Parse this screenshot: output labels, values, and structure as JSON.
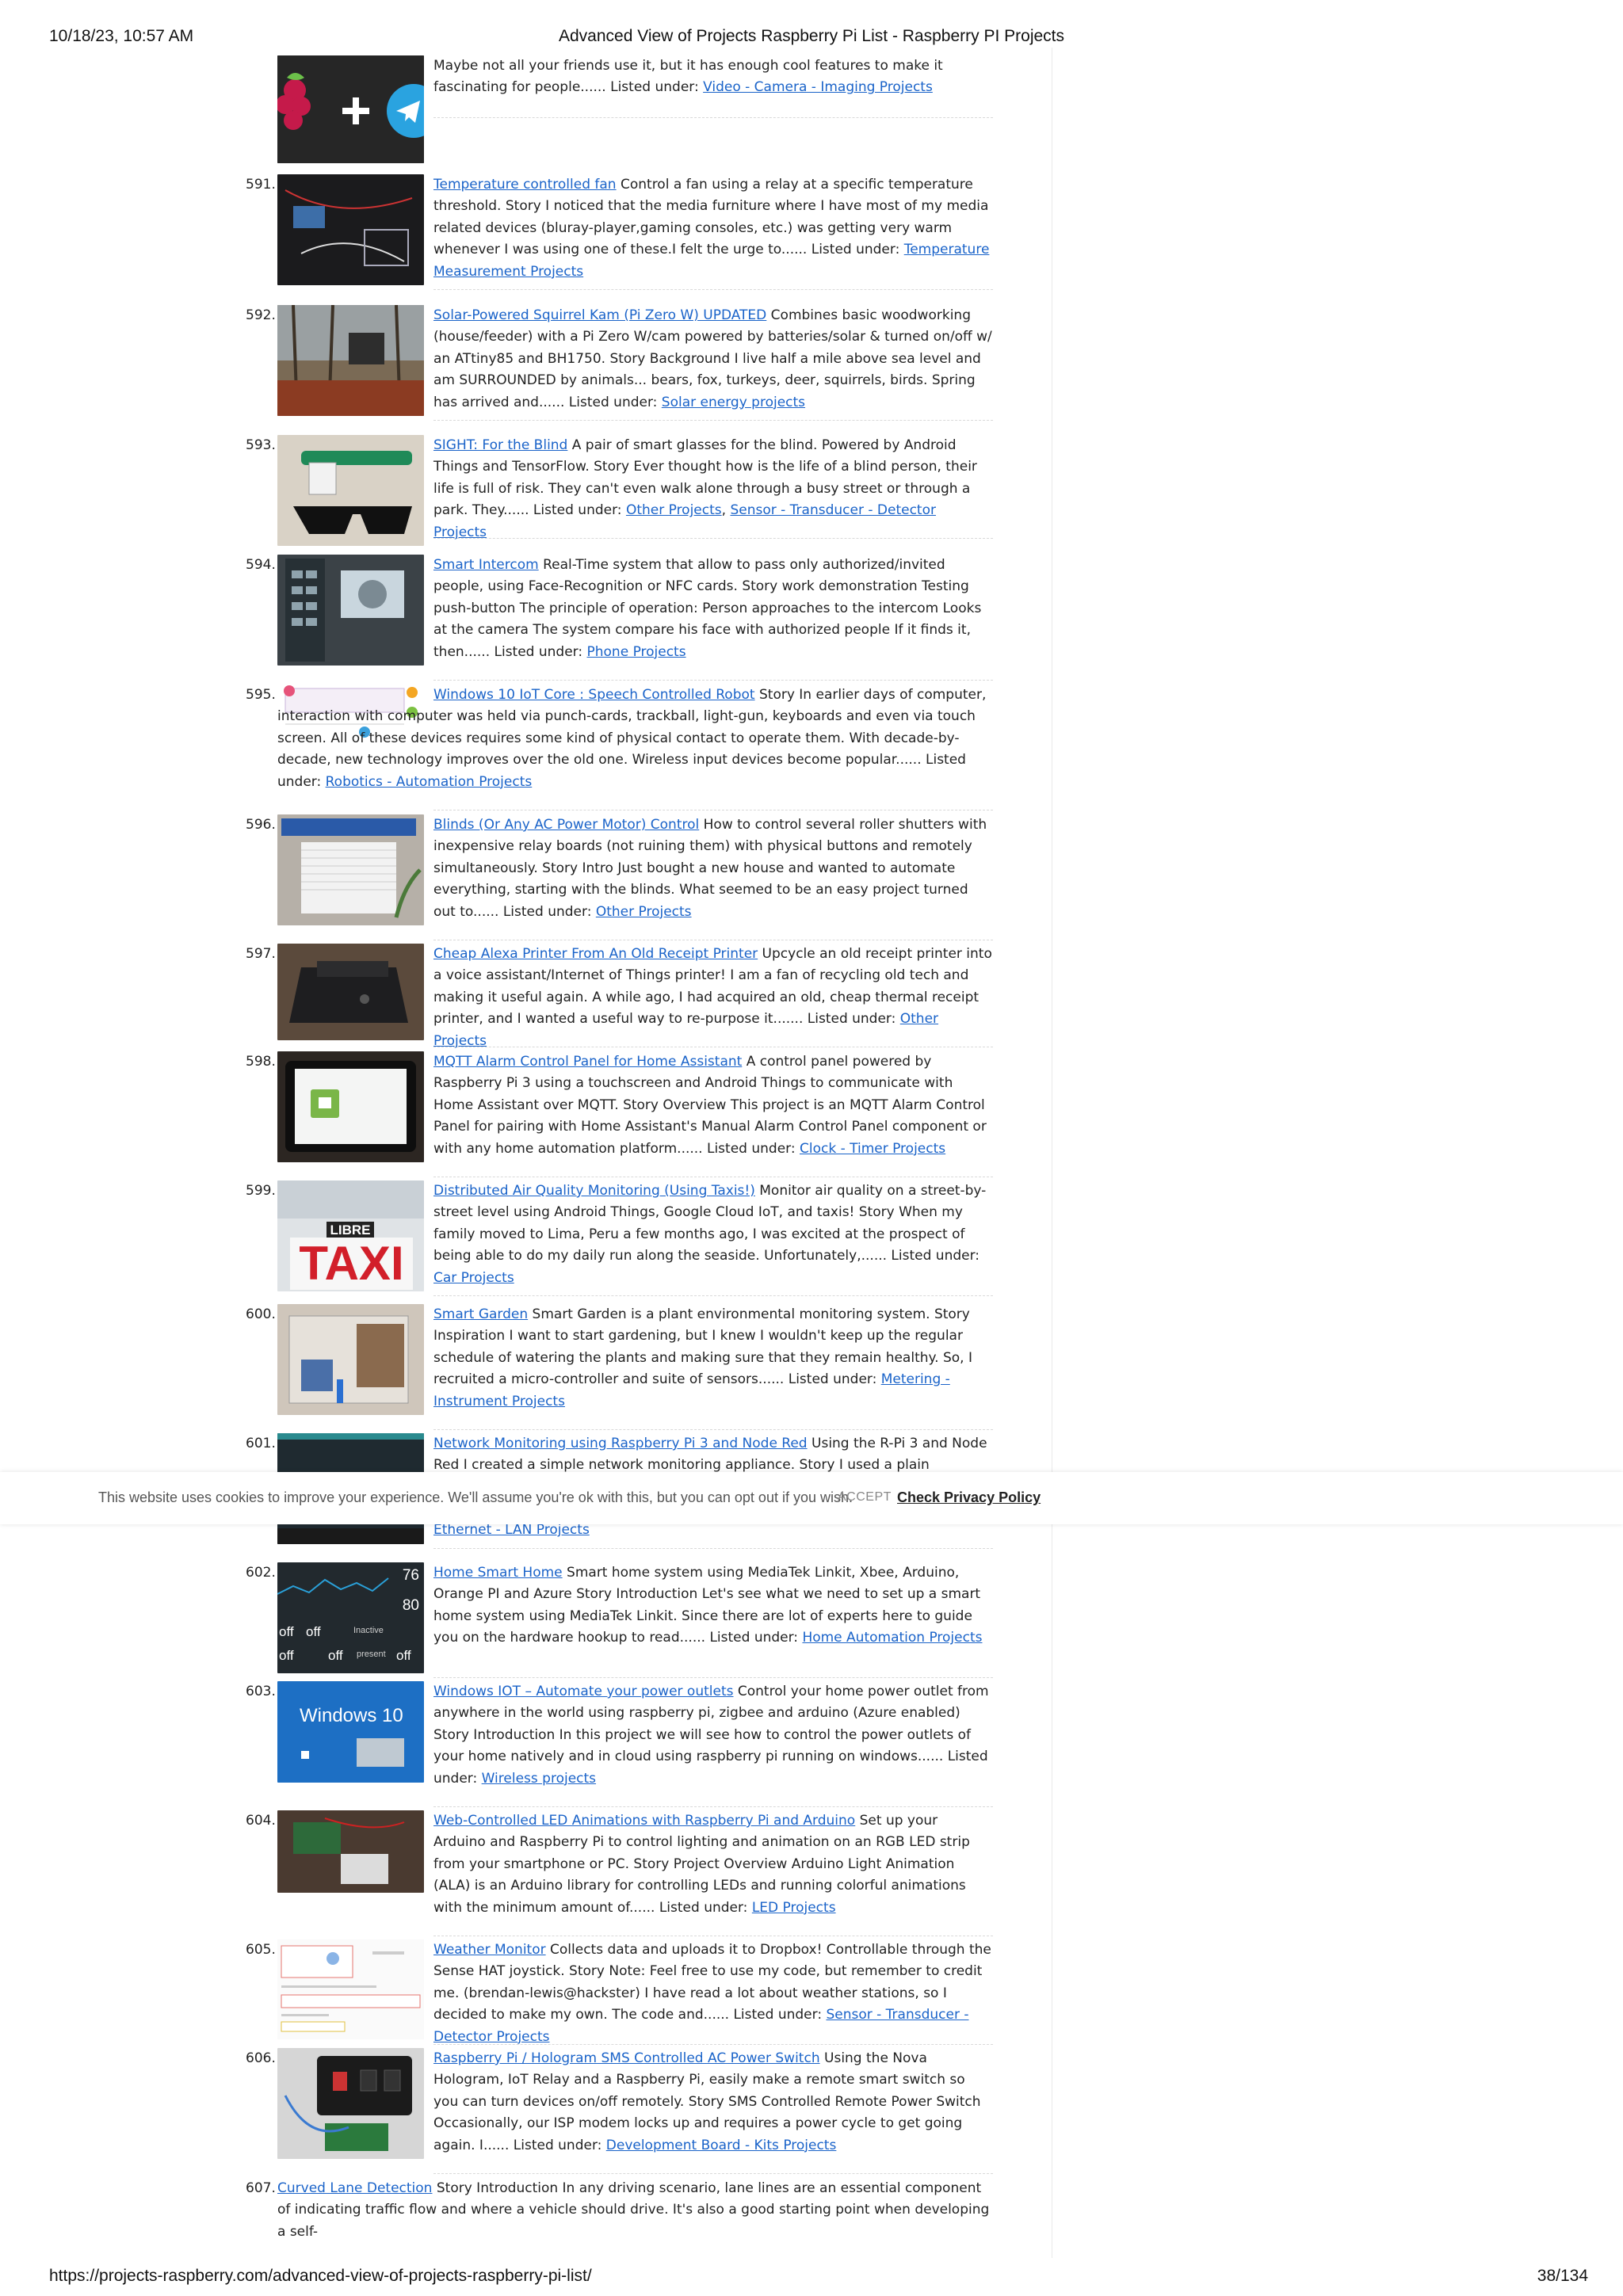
{
  "header": {
    "datetime": "10/18/23, 10:57 AM",
    "title": "Advanced View of Projects Raspberry Pi List - Raspberry PI Projects"
  },
  "footer": {
    "url": "https://projects-raspberry.com/advanced-view-of-projects-raspberry-pi-list/",
    "page": "38/134"
  },
  "cookie": {
    "message": "This website uses cookies to improve your experience. We'll assume you're ok with this, but you can opt out if you wish.",
    "accept": "ACCEPT",
    "policy": "Check Privacy Policy"
  },
  "items": [
    {
      "num": "",
      "title": "",
      "text": "Maybe not all your friends use it, but it has enough cool features to make it fascinating for people...... Listed under: ",
      "categories": [
        "Video - Camera - Imaging Projects"
      ],
      "thumb_icon": "raspberry-telegram-logo-icon"
    },
    {
      "num": "591.",
      "title": "Temperature controlled fan",
      "text": " Control a fan using a relay at a specific temperature threshold. Story I noticed that the media furniture where I have most of my media related devices (bluray-player,gaming consoles, etc.) was getting very warm whenever I was using one of these.I felt the urge to...... Listed under: ",
      "categories": [
        "Temperature Measurement Projects"
      ],
      "thumb_icon": "fan-circuit-photo-icon"
    },
    {
      "num": "592.",
      "title": "Solar-Powered Squirrel Kam (Pi Zero W) UPDATED",
      "text": " Combines basic woodworking (house/feeder) with a Pi Zero W/cam powered by batteries/solar & turned on/off w/ an ATtiny85 and BH1750. Story Background I live half a mile above sea level and am SURROUNDED by animals... bears, fox, turkeys, deer, squirrels, birds. Spring has arrived and...... Listed under: ",
      "categories": [
        "Solar energy projects"
      ],
      "thumb_icon": "squirrel-feeder-photo-icon"
    },
    {
      "num": "593.",
      "title": "SIGHT: For the Blind",
      "text": " A pair of smart glasses for the blind. Powered by Android Things and TensorFlow. Story Ever thought how is the life of a blind person, their life is full of risk. They can't even walk alone through a busy street or through a park. They...... Listed under: ",
      "categories": [
        "Other Projects",
        "Sensor - Transducer - Detector Projects"
      ],
      "thumb_icon": "smart-glasses-photo-icon"
    },
    {
      "num": "594.",
      "title": "Smart Intercom",
      "text": " Real-Time system that allow to pass only authorized/invited people, using Face-Recognition or NFC cards. Story work demonstration Testing push-button The principle of operation: Person approaches to the intercom Looks at the camera The system compare his face with authorized people If it finds it, then...... Listed under: ",
      "categories": [
        "Phone Projects"
      ],
      "thumb_icon": "intercom-photo-icon"
    },
    {
      "num": "595.",
      "title": "Windows 10 IoT Core : Speech Controlled Robot",
      "text": " Story In earlier days of computer, interaction with computer was held via punch-cards, trackball, light-gun, keyboards and even via touch screen. All of these devices requires some kind of physical contact to operate them. With decade-by-decade, new technology improves over the old one. Wireless input devices become popular...... Listed under: ",
      "categories": [
        "Robotics - Automation Projects"
      ],
      "thumb_icon": "robot-diagram-icon"
    },
    {
      "num": "596.",
      "title": "Blinds (Or Any AC Power Motor) Control",
      "text": " How to control several roller shutters with inexpensive relay boards (not ruining them) with physical buttons and remotely simultaneously. Story Intro Just bought a new house and wanted to automate everything, starting with the blinds. What seemed to be an easy project turned out to...... Listed under: ",
      "categories": [
        "Other Projects"
      ],
      "thumb_icon": "blinds-photo-icon"
    },
    {
      "num": "597.",
      "title": "Cheap Alexa Printer From An Old Receipt Printer",
      "text": " Upcycle an old receipt printer into a voice assistant/Internet of Things printer! I am a fan of recycling old tech and making it useful again. A while ago, I had acquired an old, cheap thermal receipt printer, and I wanted a useful way to re-purpose it....... Listed under: ",
      "categories": [
        "Other Projects"
      ],
      "thumb_icon": "receipt-printer-photo-icon"
    },
    {
      "num": "598.",
      "title": "MQTT Alarm Control Panel for Home Assistant",
      "text": " A control panel powered by Raspberry Pi 3 using a touchscreen and Android Things to communicate with Home Assistant over MQTT. Story Overview This project is an MQTT Alarm Control Panel for pairing with Home Assistant's Manual Alarm Control Panel component or with any home automation platform...... Listed under: ",
      "categories": [
        "Clock - Timer Projects"
      ],
      "thumb_icon": "alarm-panel-photo-icon"
    },
    {
      "num": "599.",
      "title": "Distributed Air Quality Monitoring (Using Taxis!)",
      "text": " Monitor air quality on a street-by-street level using Android Things, Google Cloud IoT, and taxis! Story When my family moved to Lima, Peru a few months ago, I was excited at the prospect of being able to do my daily run along the seaside. Unfortunately,...... Listed under: ",
      "categories": [
        "Car Projects"
      ],
      "thumb_icon": "taxi-sign-photo-icon",
      "thumb_text": [
        "LIBRE",
        "TAXI"
      ]
    },
    {
      "num": "600.",
      "title": "Smart Garden",
      "text": " Smart Garden is a plant environmental monitoring system. Story Inspiration I want to start gardening, but I knew I wouldn't keep up the regular schedule of watering the plants and making sure that they remain healthy. So, I recruited a micro-controller and suite of sensors...... Listed under: ",
      "categories": [
        "Metering - Instrument Projects"
      ],
      "thumb_icon": "garden-box-photo-icon"
    },
    {
      "num": "601.",
      "title": "Network Monitoring using Raspberry Pi 3 and Node Red",
      "text": " Using the R-Pi 3 and Node Red I created a simple network monitoring appliance. Story I used a plain Raspberry Pi",
      "categories": [
        "Ethernet - LAN Projects"
      ],
      "thumb_icon": "dashboard-screenshot-icon"
    },
    {
      "num": "602.",
      "title": "Home Smart Home",
      "text": " Smart home system using MediaTek Linkit, Xbee, Arduino, Orange PI and Azure Story Introduction Let's see what we need to set up a smart home system using MediaTek Linkit. Since there are lot of experts here to guide you on the hardware hookup to read...... Listed under: ",
      "categories": [
        "Home Automation Projects"
      ],
      "thumb_icon": "smart-home-dashboard-icon",
      "thumb_text": [
        "76",
        "80",
        "off",
        "off",
        "Inactive",
        "off",
        "off",
        "present",
        "off"
      ]
    },
    {
      "num": "603.",
      "title": "Windows IOT – Automate your power outlets",
      "text": " Control your home power outlet from anywhere in the world using raspberry pi, zigbee and arduino (Azure enabled) Story Introduction In this project we will see how to control the power outlets of your home natively and in cloud using raspberry pi running on windows...... Listed under: ",
      "categories": [
        "Wireless projects"
      ],
      "thumb_icon": "windows-logo-icon",
      "thumb_text": [
        "Windows 10"
      ]
    },
    {
      "num": "604.",
      "title": "Web-Controlled LED Animations with Raspberry Pi and Arduino",
      "text": " Set up your Arduino and Raspberry Pi to control lighting and animation on an RGB LED strip from your smartphone or PC. Story Project Overview Arduino Light Animation (ALA) is an Arduino library for controlling LEDs and running colorful animations with the minimum amount of...... Listed under: ",
      "categories": [
        "LED Projects"
      ],
      "thumb_icon": "led-board-photo-icon"
    },
    {
      "num": "605.",
      "title": "Weather Monitor",
      "text": " Collects data and uploads it to Dropbox! Controllable through the Sense HAT joystick. Story Note: Feel free to use my code, but remember to credit me. (brendan-lewis@hackster) I have read a lot about weather stations, so I decided to make my own. The code and...... Listed under: ",
      "categories": [
        "Sensor - Transducer - Detector Projects"
      ],
      "thumb_icon": "weather-screenshot-icon"
    },
    {
      "num": "606.",
      "title": "Raspberry Pi / Hologram SMS Controlled AC Power Switch",
      "text": " Using the Nova Hologram, IoT Relay and a Raspberry Pi, easily make a remote smart switch so you can turn devices on/off remotely. Story SMS Controlled Remote Power Switch Occasionally, our ISP modem locks up and requires a power cycle to get going again. I...... Listed under: ",
      "categories": [
        "Development Board - Kits Projects"
      ],
      "thumb_icon": "power-switch-photo-icon"
    },
    {
      "num": "607.",
      "title": "Curved Lane Detection",
      "text": " Story Introduction In any driving scenario, lane lines are an essential component of indicating traffic flow and where a vehicle should drive. It's also a good starting point when developing a self-",
      "categories": [],
      "thumb_icon": ""
    }
  ]
}
